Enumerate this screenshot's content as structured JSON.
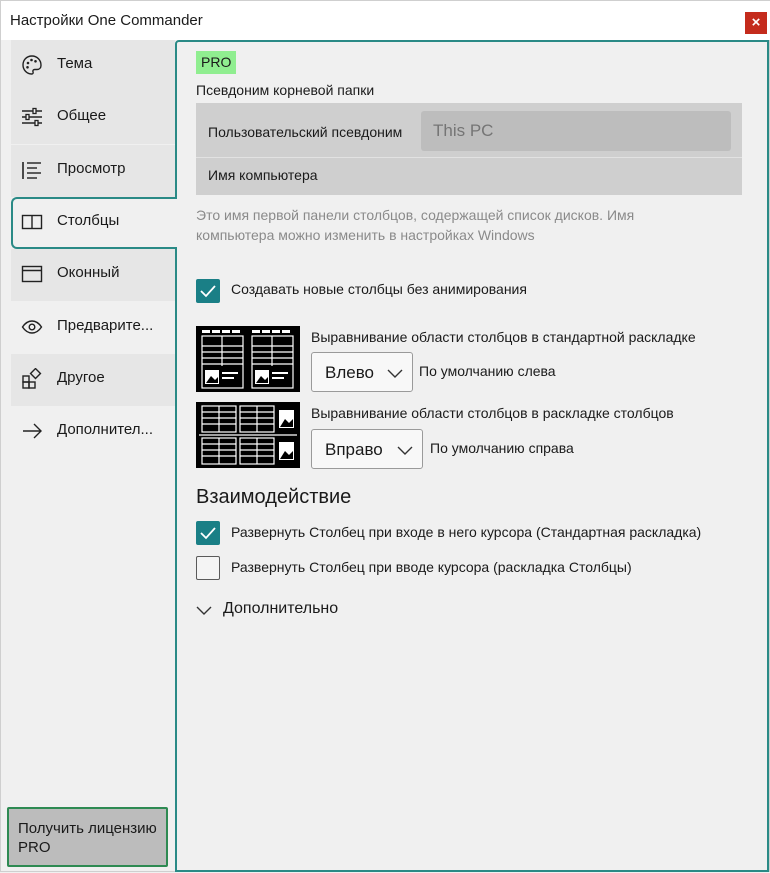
{
  "window": {
    "title": "Настройки One Commander",
    "close": "×"
  },
  "sidebar": {
    "items": [
      {
        "label": "Тема",
        "icon": "palette-icon"
      },
      {
        "label": "Общее",
        "icon": "sliders-icon"
      },
      {
        "label": "Просмотр",
        "icon": "list-icon"
      },
      {
        "label": "Столбцы",
        "icon": "columns-icon",
        "active": true
      },
      {
        "label": "Оконный",
        "icon": "window-icon"
      },
      {
        "label": "Предварите...",
        "icon": "eye-icon"
      },
      {
        "label": "Другое",
        "icon": "apps-add-icon"
      },
      {
        "label": "Дополнител...",
        "icon": "arrow-right-icon"
      }
    ],
    "license_button": "Получить лицензию PRO"
  },
  "content": {
    "pro_badge": "PRO",
    "alias_section_label": "Псевдоним корневой папки",
    "custom_alias_label": "Пользовательский псевдоним",
    "custom_alias_placeholder": "This PC",
    "computer_name_label": "Имя компьютера",
    "hint": "Это имя первой панели столбцов, содержащей список дисков. Имя компьютера можно изменить в настройках Windows",
    "no_animation": {
      "label": "Создавать новые столбцы без анимирования",
      "checked": true
    },
    "align_standard": {
      "title": "Выравнивание области столбцов в стандартной раскладке",
      "value": "Влево",
      "default_text": "По умолчанию слева"
    },
    "align_columns": {
      "title": "Выравнивание области столбцов в раскладке столбцов",
      "value": "Вправо",
      "default_text": "По умолчанию справа"
    },
    "interaction_heading": "Взаимодействие",
    "expand_standard": {
      "label": "Развернуть Столбец при входе в него курсора (Стандартная раскладка)",
      "checked": true
    },
    "expand_columns": {
      "label": "Развернуть Столбец при вводе курсора (раскладка Столбцы)",
      "checked": false
    },
    "advanced_expander": "Дополнительно"
  },
  "colors": {
    "accent": "#2a8a86",
    "checkbox_on": "#1a7f86",
    "pro_badge": "#90ee90",
    "close": "#c42b1c"
  }
}
